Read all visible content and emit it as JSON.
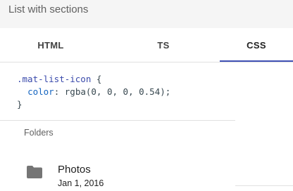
{
  "header": {
    "title": "List with sections"
  },
  "tabs": [
    {
      "label": "HTML"
    },
    {
      "label": "TS"
    },
    {
      "label": "CSS"
    }
  ],
  "code": {
    "selector": ".mat-list-icon",
    "open_brace": " {",
    "property": "color",
    "colon": ": ",
    "value": "rgba(0, 0, 0, 0.54);",
    "close_brace": "}"
  },
  "section": {
    "label": "Folders"
  },
  "items": [
    {
      "title": "Photos",
      "subtitle": "Jan 1, 2016",
      "icon": "folder-icon"
    }
  ],
  "colors": {
    "accent": "#3f51b5",
    "header_bg": "#f5f5f5",
    "icon": "#757575"
  }
}
